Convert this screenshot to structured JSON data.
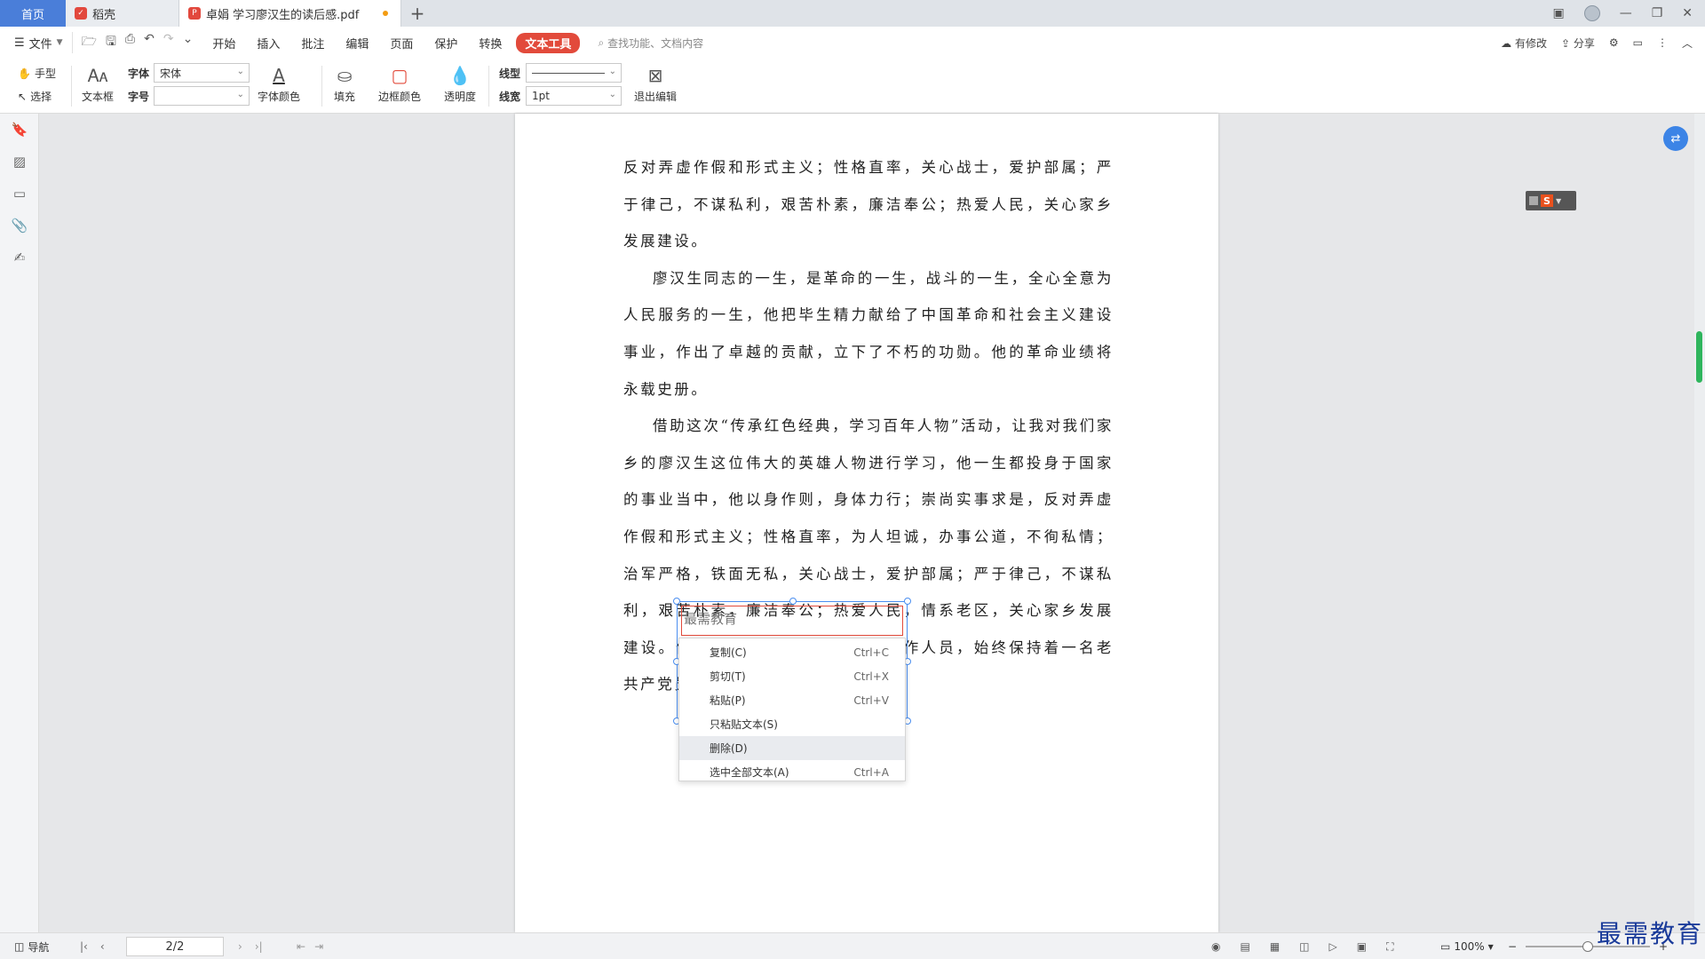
{
  "tabs": {
    "home": "首页",
    "daoke": "稻壳",
    "doc": "卓娟 学习廖汉生的读后感.pdf",
    "doc_logo": "P"
  },
  "menu": {
    "file": "文件",
    "items": [
      "开始",
      "插入",
      "批注",
      "编辑",
      "页面",
      "保护",
      "转换"
    ],
    "active": "文本工具",
    "search_placeholder": "查找功能、文档内容",
    "right": {
      "modified": "有修改",
      "share": "分享"
    }
  },
  "toolbar": {
    "hand": "手型",
    "select": "选择",
    "textbox": "文本框",
    "font_label": "字体",
    "font_value": "宋体",
    "size_label": "字号",
    "size_value": "",
    "font_color": "字体颜色",
    "fill": "填充",
    "border_color": "边框颜色",
    "opacity": "透明度",
    "line_type_label": "线型",
    "line_width_label": "线宽",
    "line_width_value": "1pt",
    "exit_edit": "退出编辑"
  },
  "document": {
    "p1": "反对弄虚作假和形式主义；性格直率，关心战士，爱护部属；严于律己，不谋私利，艰苦朴素，廉洁奉公；热爱人民，关心家乡发展建设。",
    "p2": "廖汉生同志的一生，是革命的一生，战斗的一生，全心全意为人民服务的一生，他把毕生精力献给了中国革命和社会主义建设事业，作出了卓越的贡献，立下了不朽的功勋。他的革命业绩将永载史册。",
    "p3": "借助这次“传承红色经典，学习百年人物”活动，让我对我们家乡的廖汉生这位伟大的英雄人物进行学习，他一生都投身于国家的事业当中，他以身作则，身体力行；崇尚实事求是，反对弄虚作假和形式主义；性格直率，为人坦诚，办事公道，不徇私情；治军严格，铁面无私，关心战士，爱护部属；严于律己，不谋私利，艰苦朴素，廉洁奉公；热爱人民，情系老区，关心家乡发展建设。他严格要求子女亲属和身边工作人员，始终保持着一名老共产党员和老红军战士的本色。",
    "textbox_text": "最需教育"
  },
  "context_menu": [
    {
      "label": "复制(C)",
      "shortcut": "Ctrl+C"
    },
    {
      "label": "剪切(T)",
      "shortcut": "Ctrl+X"
    },
    {
      "label": "粘贴(P)",
      "shortcut": "Ctrl+V"
    },
    {
      "label": "只粘贴文本(S)",
      "shortcut": ""
    },
    {
      "label": "删除(D)",
      "shortcut": ""
    },
    {
      "label": "选中全部文本(A)",
      "shortcut": "Ctrl+A"
    }
  ],
  "status": {
    "nav": "导航",
    "page": "2/2",
    "zoom": "100%"
  },
  "watermark": "最需教育",
  "colors": {
    "accent": "#e24a3b",
    "home_tab": "#4a7ed9",
    "scroll_thumb": "#2fb55d"
  }
}
